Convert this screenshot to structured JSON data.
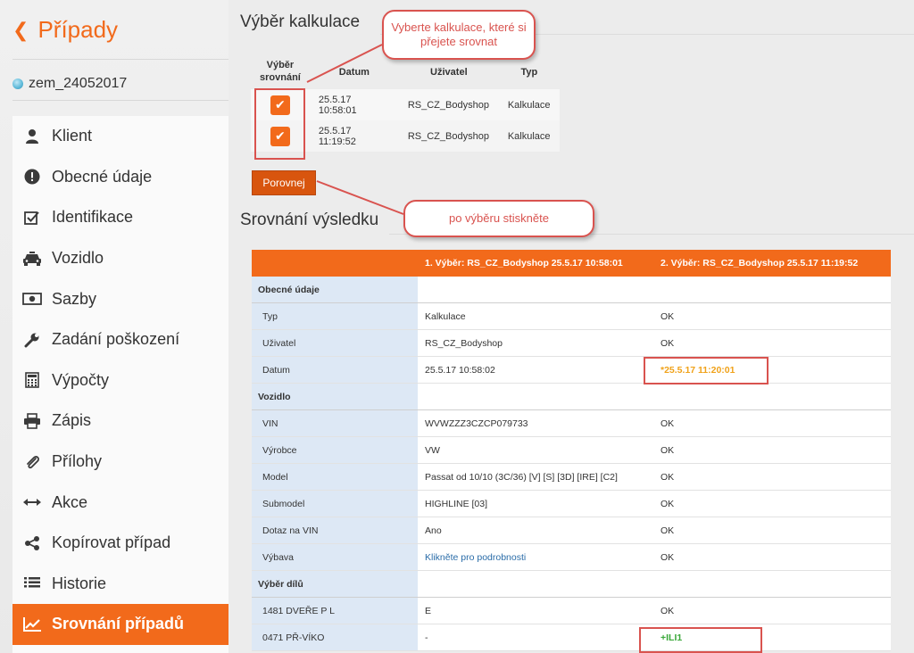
{
  "sidebar": {
    "back_label": "Případy",
    "case_id": "zem_24052017",
    "items": [
      {
        "label": "Klient",
        "icon": "user-icon"
      },
      {
        "label": "Obecné údaje",
        "icon": "exclamation-icon"
      },
      {
        "label": "Identifikace",
        "icon": "checkbox-icon"
      },
      {
        "label": "Vozidlo",
        "icon": "car-icon"
      },
      {
        "label": "Sazby",
        "icon": "money-icon"
      },
      {
        "label": "Zadání poškození",
        "icon": "wrench-icon"
      },
      {
        "label": "Výpočty",
        "icon": "calculator-icon"
      },
      {
        "label": "Zápis",
        "icon": "printer-icon"
      },
      {
        "label": "Přílohy",
        "icon": "paperclip-icon"
      },
      {
        "label": "Akce",
        "icon": "arrows-icon"
      },
      {
        "label": "Kopírovat případ",
        "icon": "share-icon"
      },
      {
        "label": "Historie",
        "icon": "list-icon"
      },
      {
        "label": "Srovnání případů",
        "icon": "chart-icon",
        "active": true
      }
    ]
  },
  "selection": {
    "title": "Výběr kalkulace",
    "headers": {
      "compare": "Výběr srovnání",
      "date": "Datum",
      "user": "Uživatel",
      "type": "Typ"
    },
    "rows": [
      {
        "date": "25.5.17 10:58:01",
        "user": "RS_CZ_Bodyshop",
        "type": "Kalkulace",
        "checked": true
      },
      {
        "date": "25.5.17 11:19:52",
        "user": "RS_CZ_Bodyshop",
        "type": "Kalkulace",
        "checked": true
      }
    ],
    "button": "Porovnej"
  },
  "callouts": {
    "top": "Vyberte kalkulace, které si přejete srovnat",
    "bottom": "po výběru stiskněte"
  },
  "results": {
    "title": "Srovnání výsledku",
    "head": {
      "col1": "",
      "col2": "1. Výběr: RS_CZ_Bodyshop 25.5.17 10:58:01",
      "col3": "2. Výběr: RS_CZ_Bodyshop 25.5.17 11:19:52"
    },
    "rows": [
      {
        "c1": "Obecné údaje",
        "c2": "",
        "c3": "",
        "section": true
      },
      {
        "c1": "Typ",
        "c2": "Kalkulace",
        "c3": "OK"
      },
      {
        "c1": "Uživatel",
        "c2": "RS_CZ_Bodyshop",
        "c3": "OK"
      },
      {
        "c1": "Datum",
        "c2": "25.5.17 10:58:02",
        "c3": "*25.5.17 11:20:01",
        "c3style": "warn"
      },
      {
        "c1": "Vozidlo",
        "c2": "",
        "c3": "",
        "section": true
      },
      {
        "c1": "VIN",
        "c2": "WVWZZZ3CZCP079733",
        "c3": "OK"
      },
      {
        "c1": "Výrobce",
        "c2": "VW",
        "c3": "OK"
      },
      {
        "c1": "Model",
        "c2": "Passat od 10/10 (3C/36) [V] [S] [3D] [IRE] [C2]",
        "c3": "OK"
      },
      {
        "c1": "Submodel",
        "c2": "HIGHLINE [03]",
        "c3": "OK"
      },
      {
        "c1": "Dotaz na VIN",
        "c2": "Ano",
        "c3": "OK"
      },
      {
        "c1": "Výbava",
        "c2": "Klikněte pro podrobnosti",
        "c2style": "link",
        "c3": "OK"
      },
      {
        "c1": "Výběr dílů",
        "c2": "",
        "c3": "",
        "section": true
      },
      {
        "c1": "1481 DVEŘE P L",
        "c2": "E",
        "c3": "OK"
      },
      {
        "c1": "0471 PŘ-VÍKO",
        "c2": "-",
        "c3": "+ILI1",
        "c3style": "plus"
      }
    ]
  }
}
